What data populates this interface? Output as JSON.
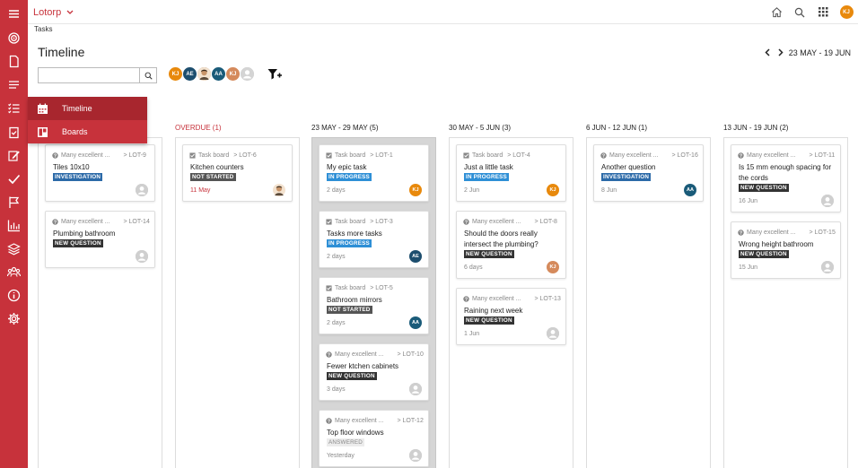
{
  "app": {
    "name": "Lotorp",
    "breadcrumb": "Tasks",
    "page_title": "Timeline",
    "user_initials": "KJ"
  },
  "colors": {
    "brand": "#c7323b",
    "orange": "#e8890c",
    "navy": "#1d4e6e",
    "teal": "#1a5b79",
    "tan": "#d58a5c"
  },
  "sidebar": {
    "icons": [
      "menu-icon",
      "target-icon",
      "document-icon",
      "list-icon",
      "checklist-icon",
      "clipboard-icon",
      "edit-icon",
      "check-icon",
      "flag-icon",
      "chart-icon",
      "layers-icon",
      "team-icon",
      "info-icon",
      "settings-icon"
    ]
  },
  "view_menu": [
    {
      "label": "Timeline",
      "icon": "calendar-icon",
      "active": true
    },
    {
      "label": "Boards",
      "icon": "board-icon",
      "active": false
    }
  ],
  "search": {
    "placeholder": "",
    "value": ""
  },
  "avatars": [
    {
      "initials": "KJ",
      "color": "#e8890c"
    },
    {
      "initials": "AE",
      "color": "#1d4e6e"
    },
    {
      "initials": "",
      "color": "#8a6a4a",
      "photo": true
    },
    {
      "initials": "AA",
      "color": "#1a5b79"
    },
    {
      "initials": "KJ",
      "color": "#d58a5c"
    },
    {
      "initials": "",
      "color": "#cccccc",
      "ghost": true
    }
  ],
  "date_range": "23 MAY - 19 JUN",
  "columns": [
    {
      "label": "",
      "cards": [
        {
          "source": "Many excellent ...",
          "lot": "> LOT-9",
          "kind": "question",
          "title": "Tiles 10x10",
          "status": "INVESTIGATION",
          "status_class": "b-inv",
          "date": "",
          "assignee": "",
          "assignee_type": "ghost"
        },
        {
          "source": "Many excellent ...",
          "lot": "> LOT-14",
          "kind": "question",
          "title": "Plumbing bathroom",
          "status": "NEW QUESTION",
          "status_class": "b-nq",
          "date": "",
          "assignee": "",
          "assignee_type": "ghost"
        }
      ]
    },
    {
      "label": "OVERDUE (1)",
      "cards": [
        {
          "source": "Task board",
          "lot": "> LOT-6",
          "kind": "task",
          "title": "Kitchen counters",
          "status": "NOT STARTED",
          "status_class": "b-ns",
          "date": "11 May",
          "date_red": true,
          "assignee": "",
          "assignee_type": "photo"
        }
      ]
    },
    {
      "label": "23 MAY - 29 MAY (5)",
      "cards": [
        {
          "source": "Task board",
          "lot": "> LOT-1",
          "kind": "task",
          "title": "My epic task",
          "status": "IN PROGRESS",
          "status_class": "b-ip",
          "date": "2 days",
          "assignee": "KJ",
          "assignee_type": "orange"
        },
        {
          "source": "Task board",
          "lot": "> LOT-3",
          "kind": "task",
          "title": "Tasks more tasks",
          "status": "IN PROGRESS",
          "status_class": "b-ip",
          "date": "2 days",
          "assignee": "AE",
          "assignee_type": "navy"
        },
        {
          "source": "Task board",
          "lot": "> LOT-5",
          "kind": "task",
          "title": "Bathroom mirrors",
          "status": "NOT STARTED",
          "status_class": "b-ns",
          "date": "2 days",
          "assignee": "AA",
          "assignee_type": "teal"
        },
        {
          "source": "Many excellent ...",
          "lot": "> LOT-10",
          "kind": "question",
          "title": "Fewer ktchen cabinets",
          "status": "NEW QUESTION",
          "status_class": "b-nq",
          "date": "3 days",
          "assignee": "",
          "assignee_type": "ghost"
        },
        {
          "source": "Many excellent ...",
          "lot": "> LOT-12",
          "kind": "question",
          "title": "Top floor windows",
          "status": "ANSWERED",
          "status_class": "b-ans",
          "date": "Yesterday",
          "assignee": "",
          "assignee_type": "ghost"
        }
      ]
    },
    {
      "label": "30 MAY - 5 JUN (3)",
      "cards": [
        {
          "source": "Task board",
          "lot": "> LOT-4",
          "kind": "task",
          "title": "Just a little task",
          "status": "IN PROGRESS",
          "status_class": "b-ip",
          "date": "2 Jun",
          "assignee": "KJ",
          "assignee_type": "orange"
        },
        {
          "source": "Many excellent ...",
          "lot": "> LOT-8",
          "kind": "question",
          "title": "Should the doors really intersect the plumbing?",
          "status": "NEW QUESTION",
          "status_class": "b-nq",
          "date": "6 days",
          "assignee": "KJ",
          "assignee_type": "tan"
        },
        {
          "source": "Many excellent ...",
          "lot": "> LOT-13",
          "kind": "question",
          "title": "Raining next week",
          "status": "NEW QUESTION",
          "status_class": "b-nq",
          "date": "1 Jun",
          "assignee": "",
          "assignee_type": "ghost"
        }
      ]
    },
    {
      "label": "6 JUN - 12 JUN (1)",
      "cards": [
        {
          "source": "Many excellent ...",
          "lot": "> LOT-16",
          "kind": "question",
          "title": "Another question",
          "status": "INVESTIGATION",
          "status_class": "b-inv",
          "date": "8 Jun",
          "assignee": "AA",
          "assignee_type": "teal"
        }
      ]
    },
    {
      "label": "13 JUN - 19 JUN (2)",
      "cards": [
        {
          "source": "Many excellent ...",
          "lot": "> LOT-11",
          "kind": "question",
          "title": "Is 15 mm enough spacing for the cords",
          "status": "NEW QUESTION",
          "status_class": "b-nq",
          "date": "16 Jun",
          "assignee": "",
          "assignee_type": "ghost"
        },
        {
          "source": "Many excellent ...",
          "lot": "> LOT-15",
          "kind": "question",
          "title": "Wrong height bathroom",
          "status": "NEW QUESTION",
          "status_class": "b-nq",
          "date": "15 Jun",
          "assignee": "",
          "assignee_type": "ghost"
        }
      ]
    }
  ]
}
